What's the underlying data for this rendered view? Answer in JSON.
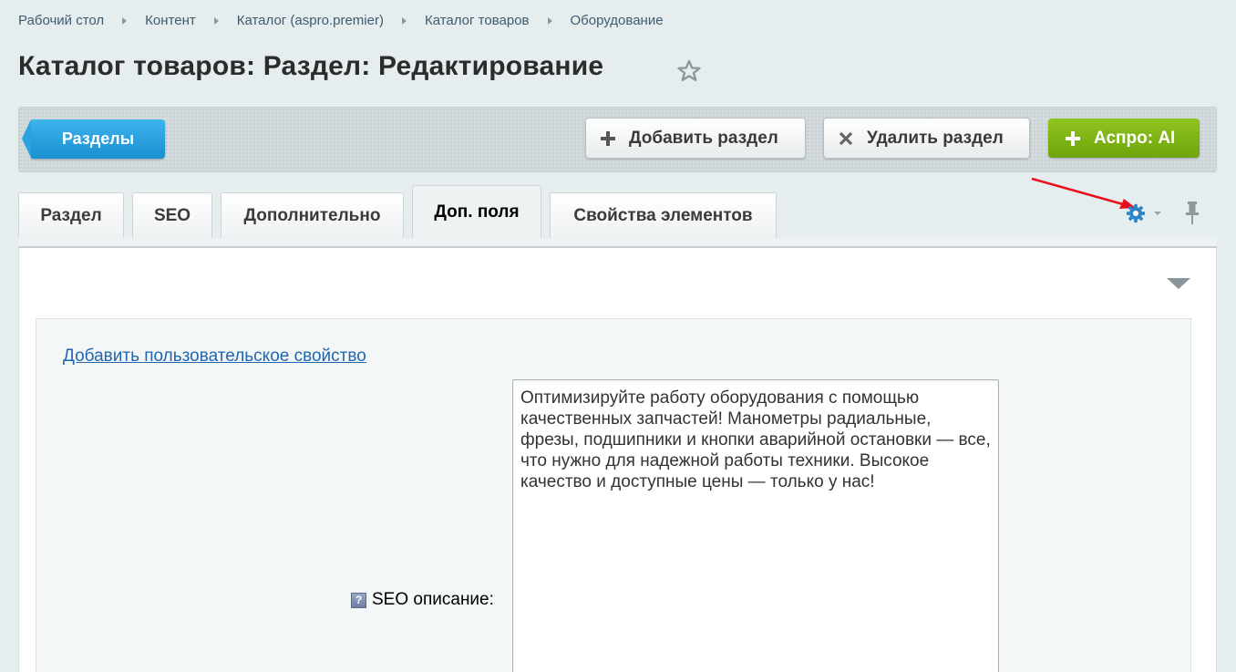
{
  "breadcrumb": [
    "Рабочий стол",
    "Контент",
    "Каталог (aspro.premier)",
    "Каталог товаров",
    "Оборудование"
  ],
  "page": {
    "title": "Каталог товаров: Раздел: Редактирование"
  },
  "toolbar": {
    "sections_label": "Разделы",
    "add_label": "Добавить раздел",
    "delete_label": "Удалить раздел",
    "ai_label": "Аспро: AI"
  },
  "tabs": [
    {
      "label": "Раздел",
      "active": false
    },
    {
      "label": "SEO",
      "active": false
    },
    {
      "label": "Дополнительно",
      "active": false
    },
    {
      "label": "Доп. поля",
      "active": true
    },
    {
      "label": "Свойства элементов",
      "active": false
    }
  ],
  "form": {
    "add_property_link": "Добавить пользовательское свойство",
    "seo_label": "SEO описание:",
    "help_glyph": "?",
    "seo_value": "Оптимизируйте работу оборудования с помощью качественных запчастей! Манометры радиальные, фрезы, подшипники и кнопки аварийной остановки — все, что нужно для надежной работы техники. Высокое качество и доступные цены — только у нас!"
  },
  "colors": {
    "accent_blue": "#1a8fd1",
    "accent_green": "#7ab215",
    "annotation_red": "#e8101b"
  },
  "icons": [
    "star-icon",
    "plus-icon",
    "close-icon",
    "gear-icon",
    "pin-icon",
    "chevron-down-icon",
    "help-icon"
  ]
}
